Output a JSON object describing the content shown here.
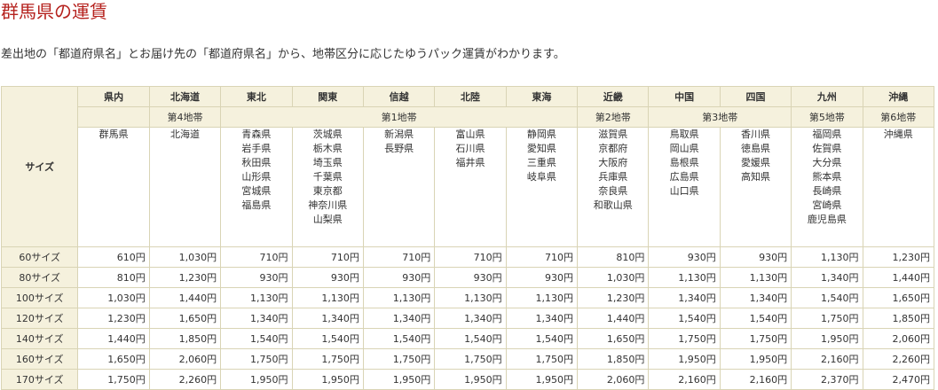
{
  "title": "群馬県の運賃",
  "intro": "差出地の「都道府県名」とお届け先の「都道府県名」から、地帯区分に応じたゆうパック運賃がわかります。",
  "corner_label": "サイズ",
  "regions": [
    "県内",
    "北海道",
    "東北",
    "関東",
    "信越",
    "北陸",
    "東海",
    "近畿",
    "中国",
    "四国",
    "九州",
    "沖縄"
  ],
  "zones": [
    {
      "label": "",
      "span": 1
    },
    {
      "label": "第4地帯",
      "span": 1
    },
    {
      "label": "第1地帯",
      "span": 5
    },
    {
      "label": "第2地帯",
      "span": 1
    },
    {
      "label": "第3地帯",
      "span": 2
    },
    {
      "label": "第5地帯",
      "span": 1
    },
    {
      "label": "第6地帯",
      "span": 1
    }
  ],
  "prefectures": [
    [
      "群馬県"
    ],
    [
      "北海道"
    ],
    [
      "青森県",
      "岩手県",
      "秋田県",
      "山形県",
      "宮城県",
      "福島県"
    ],
    [
      "茨城県",
      "栃木県",
      "埼玉県",
      "千葉県",
      "東京都",
      "神奈川県",
      "山梨県"
    ],
    [
      "新潟県",
      "長野県"
    ],
    [
      "富山県",
      "石川県",
      "福井県"
    ],
    [
      "静岡県",
      "愛知県",
      "三重県",
      "岐阜県"
    ],
    [
      "滋賀県",
      "京都府",
      "大阪府",
      "兵庫県",
      "奈良県",
      "和歌山県"
    ],
    [
      "鳥取県",
      "岡山県",
      "島根県",
      "広島県",
      "山口県"
    ],
    [
      "香川県",
      "徳島県",
      "愛媛県",
      "高知県"
    ],
    [
      "福岡県",
      "佐賀県",
      "大分県",
      "熊本県",
      "長崎県",
      "宮崎県",
      "鹿児島県"
    ],
    [
      "沖縄県"
    ]
  ],
  "rows": [
    {
      "size": "60サイズ",
      "prices": [
        "610円",
        "1,030円",
        "710円",
        "710円",
        "710円",
        "710円",
        "710円",
        "810円",
        "930円",
        "930円",
        "1,130円",
        "1,230円"
      ]
    },
    {
      "size": "80サイズ",
      "prices": [
        "810円",
        "1,230円",
        "930円",
        "930円",
        "930円",
        "930円",
        "930円",
        "1,030円",
        "1,130円",
        "1,130円",
        "1,340円",
        "1,440円"
      ]
    },
    {
      "size": "100サイズ",
      "prices": [
        "1,030円",
        "1,440円",
        "1,130円",
        "1,130円",
        "1,130円",
        "1,130円",
        "1,130円",
        "1,230円",
        "1,340円",
        "1,340円",
        "1,540円",
        "1,650円"
      ]
    },
    {
      "size": "120サイズ",
      "prices": [
        "1,230円",
        "1,650円",
        "1,340円",
        "1,340円",
        "1,340円",
        "1,340円",
        "1,340円",
        "1,440円",
        "1,540円",
        "1,540円",
        "1,750円",
        "1,850円"
      ]
    },
    {
      "size": "140サイズ",
      "prices": [
        "1,440円",
        "1,850円",
        "1,540円",
        "1,540円",
        "1,540円",
        "1,540円",
        "1,540円",
        "1,650円",
        "1,750円",
        "1,750円",
        "1,950円",
        "2,060円"
      ]
    },
    {
      "size": "160サイズ",
      "prices": [
        "1,650円",
        "2,060円",
        "1,750円",
        "1,750円",
        "1,750円",
        "1,750円",
        "1,750円",
        "1,850円",
        "1,950円",
        "1,950円",
        "2,160円",
        "2,260円"
      ]
    },
    {
      "size": "170サイズ",
      "prices": [
        "1,750円",
        "2,260円",
        "1,950円",
        "1,950円",
        "1,950円",
        "1,950円",
        "1,950円",
        "2,060円",
        "2,160円",
        "2,160円",
        "2,370円",
        "2,470円"
      ]
    }
  ]
}
